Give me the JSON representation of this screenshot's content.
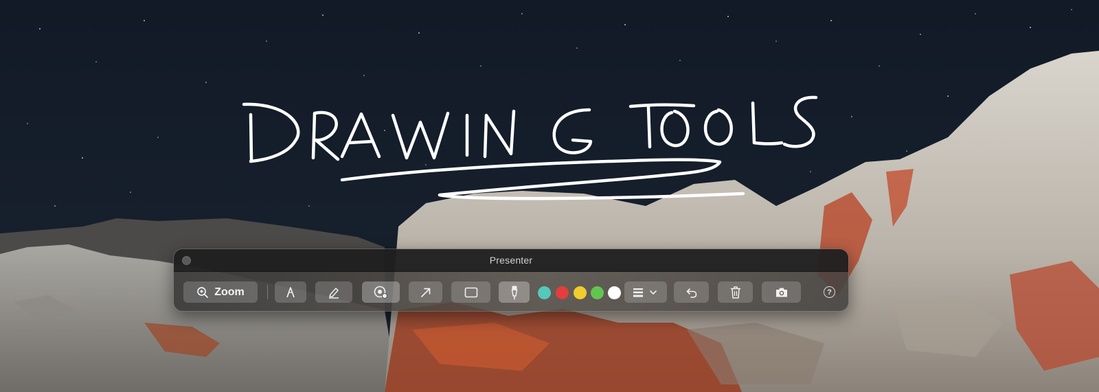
{
  "window": {
    "title": "Presenter"
  },
  "toolbar": {
    "zoom_label": "Zoom",
    "tools": [
      {
        "name": "zoom",
        "icon": "zoom-in-icon"
      },
      {
        "name": "pen",
        "icon": "pen-icon"
      },
      {
        "name": "highlighter",
        "icon": "highlighter-icon"
      },
      {
        "name": "spotlight",
        "icon": "spotlight-icon",
        "active": true
      },
      {
        "name": "arrow",
        "icon": "arrow-icon"
      },
      {
        "name": "rectangle",
        "icon": "rectangle-icon"
      },
      {
        "name": "marker",
        "icon": "marker-icon",
        "active": true
      },
      {
        "name": "stroke-width",
        "icon": "line-weight-icon"
      },
      {
        "name": "undo",
        "icon": "undo-icon"
      },
      {
        "name": "clear",
        "icon": "trash-icon"
      },
      {
        "name": "screenshot",
        "icon": "camera-icon"
      }
    ],
    "colors": [
      "#55c8bb",
      "#e43d3d",
      "#f0cc2d",
      "#62c552",
      "#ffffff"
    ],
    "help_label": "?"
  },
  "accent": {
    "ink": "#ffffff"
  }
}
